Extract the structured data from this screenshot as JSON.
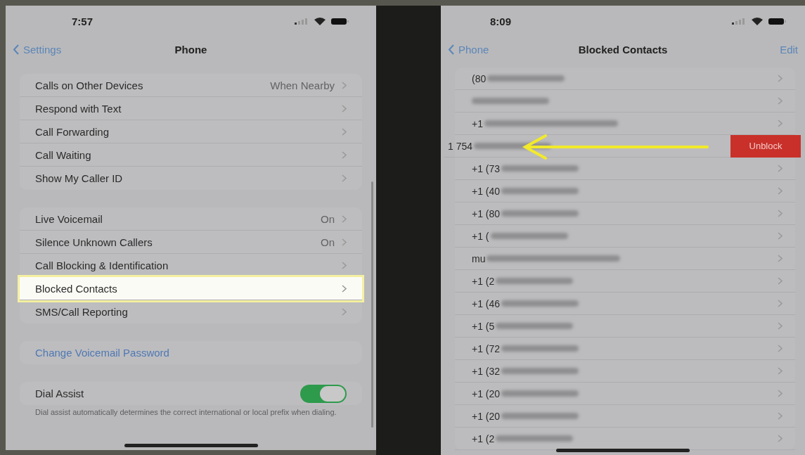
{
  "left_screen": {
    "status_bar": {
      "time": "7:57"
    },
    "nav": {
      "back": "Settings",
      "title": "Phone"
    },
    "groups": [
      {
        "rows": [
          {
            "kind": "link",
            "label": "Calls on Other Devices",
            "value": "When Nearby",
            "highlighted": false
          },
          {
            "kind": "link",
            "label": "Respond with Text",
            "highlighted": false
          },
          {
            "kind": "link",
            "label": "Call Forwarding",
            "highlighted": false
          },
          {
            "kind": "link",
            "label": "Call Waiting",
            "highlighted": false
          },
          {
            "kind": "link",
            "label": "Show My Caller ID",
            "highlighted": false
          }
        ]
      },
      {
        "rows": [
          {
            "kind": "link",
            "label": "Live Voicemail",
            "value": "On",
            "highlighted": false
          },
          {
            "kind": "link",
            "label": "Silence Unknown Callers",
            "value": "On",
            "highlighted": false
          },
          {
            "kind": "link",
            "label": "Call Blocking & Identification",
            "highlighted": false
          },
          {
            "kind": "link",
            "label": "Blocked Contacts",
            "highlighted": true
          },
          {
            "kind": "link",
            "label": "SMS/Call Reporting",
            "highlighted": false
          }
        ]
      },
      {
        "rows": [
          {
            "kind": "action",
            "label": "Change Voicemail Password",
            "highlighted": false
          }
        ]
      },
      {
        "rows": [
          {
            "kind": "toggle",
            "label": "Dial Assist",
            "on": true,
            "highlighted": false
          }
        ],
        "footer": "Dial assist automatically determines the correct international or local prefix when dialing."
      }
    ]
  },
  "right_screen": {
    "status_bar": {
      "time": "8:09"
    },
    "nav": {
      "back": "Phone",
      "title": "Blocked Contacts",
      "action": "Edit"
    },
    "contacts": [
      {
        "prefix": "(80",
        "swiped": false
      },
      {
        "swiped": false
      },
      {
        "prefix": "+1",
        "swiped": false
      },
      {
        "prefix": "1 754",
        "swiped": true
      },
      {
        "prefix": "+1 (73",
        "swiped": false
      },
      {
        "prefix": "+1 (40",
        "swiped": false
      },
      {
        "prefix": "+1 (80",
        "swiped": false
      },
      {
        "prefix": "+1 (",
        "swiped": false
      },
      {
        "prefix": "mu",
        "swiped": false
      },
      {
        "prefix": "+1 (2",
        "swiped": false
      },
      {
        "prefix": "+1 (46",
        "swiped": false
      },
      {
        "prefix": "+1 (5",
        "swiped": false
      },
      {
        "prefix": "+1 (72",
        "swiped": false
      },
      {
        "prefix": "+1 (32",
        "swiped": false
      },
      {
        "prefix": "+1 (20",
        "swiped": false
      },
      {
        "prefix": "+1 (20",
        "swiped": false
      },
      {
        "prefix": "+1 (2",
        "swiped": false
      }
    ],
    "unblock_button": "Unblock"
  }
}
